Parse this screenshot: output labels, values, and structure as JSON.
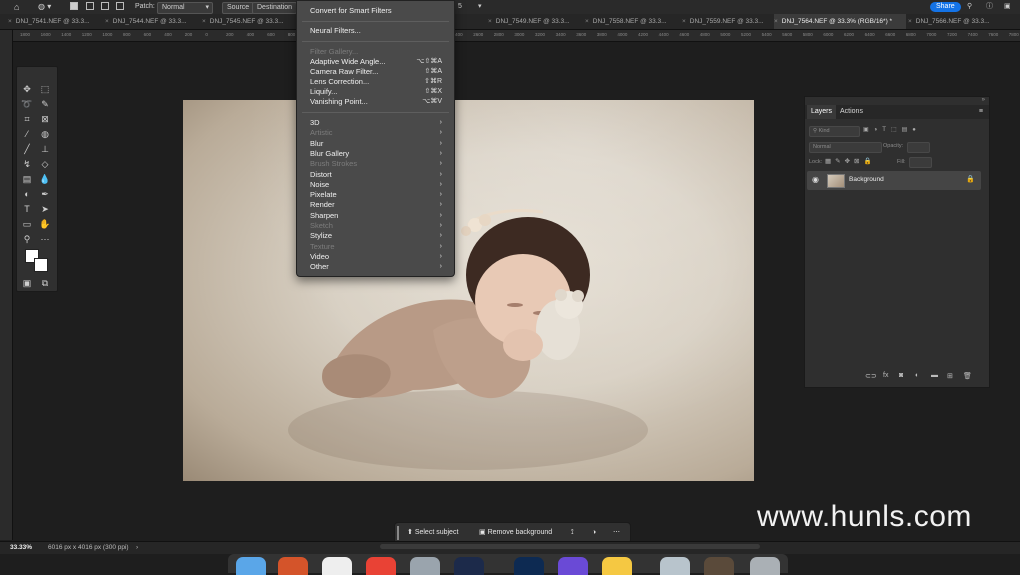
{
  "options_bar": {
    "patch_label": "Patch:",
    "patch_mode": "Normal",
    "source_label": "Source",
    "destination_label": "Destination",
    "diffusion_value": "5",
    "share_label": "Share"
  },
  "tabs": [
    {
      "label": "DNJ_7541.NEF @ 33.3..."
    },
    {
      "label": "DNJ_7544.NEF @ 33.3..."
    },
    {
      "label": "DNJ_7545.NEF @ 33.3..."
    },
    {
      "label": "DNJ_7549.NEF @ 33.3..."
    },
    {
      "label": "DNJ_7558.NEF @ 33.3..."
    },
    {
      "label": "DNJ_7559.NEF @ 33.3..."
    },
    {
      "label": "DNJ_7564.NEF @ 33.3% (RGB/16*) *"
    },
    {
      "label": "DNJ_7566.NEF @ 33.3..."
    }
  ],
  "ruler_ticks": [
    "1800",
    "1600",
    "1400",
    "1200",
    "1000",
    "800",
    "600",
    "400",
    "200",
    "0",
    "200",
    "400",
    "600",
    "800",
    "1000",
    "1200",
    "1400",
    "1600",
    "1800",
    "2000",
    "2200",
    "2400",
    "2600",
    "2800",
    "3000",
    "3200",
    "3400",
    "3600",
    "3800",
    "4000",
    "4200",
    "4400",
    "4600",
    "4800",
    "5000",
    "5200",
    "5400",
    "5600",
    "5800",
    "6000",
    "6200",
    "6400",
    "6600",
    "6800",
    "7000",
    "7200",
    "7400",
    "7600",
    "7800"
  ],
  "filter_menu": {
    "convert": "Convert for Smart Filters",
    "neural": "Neural Filters...",
    "gallery": "Filter Gallery...",
    "adaptive": {
      "label": "Adaptive Wide Angle...",
      "shortcut": "⌥⇧⌘A"
    },
    "camera_raw": {
      "label": "Camera Raw Filter...",
      "shortcut": "⇧⌘A"
    },
    "lens": {
      "label": "Lens Correction...",
      "shortcut": "⇧⌘R"
    },
    "liquify": {
      "label": "Liquify...",
      "shortcut": "⇧⌘X"
    },
    "vanishing": {
      "label": "Vanishing Point...",
      "shortcut": "⌥⌘V"
    },
    "submenus": [
      {
        "label": "3D",
        "disabled": false
      },
      {
        "label": "Artistic",
        "disabled": true
      },
      {
        "label": "Blur",
        "disabled": false
      },
      {
        "label": "Blur Gallery",
        "disabled": false
      },
      {
        "label": "Brush Strokes",
        "disabled": true
      },
      {
        "label": "Distort",
        "disabled": false
      },
      {
        "label": "Noise",
        "disabled": false
      },
      {
        "label": "Pixelate",
        "disabled": false
      },
      {
        "label": "Render",
        "disabled": false
      },
      {
        "label": "Sharpen",
        "disabled": false
      },
      {
        "label": "Sketch",
        "disabled": true
      },
      {
        "label": "Stylize",
        "disabled": false
      },
      {
        "label": "Texture",
        "disabled": true
      },
      {
        "label": "Video",
        "disabled": false
      },
      {
        "label": "Other",
        "disabled": false
      }
    ]
  },
  "layers_panel": {
    "tab_layers": "Layers",
    "tab_actions": "Actions",
    "kind": "Kind",
    "blend": "Normal",
    "opacity_label": "Opacity:",
    "lock_label": "Lock:",
    "fill_label": "Fill:",
    "layer_name": "Background"
  },
  "context_bar": {
    "select_subject": "Select subject",
    "remove_background": "Remove background"
  },
  "status": {
    "zoom": "33.33%",
    "doc_size": "6016 px x 4016 px (300 ppi)"
  },
  "watermark": "www.hunls.com"
}
